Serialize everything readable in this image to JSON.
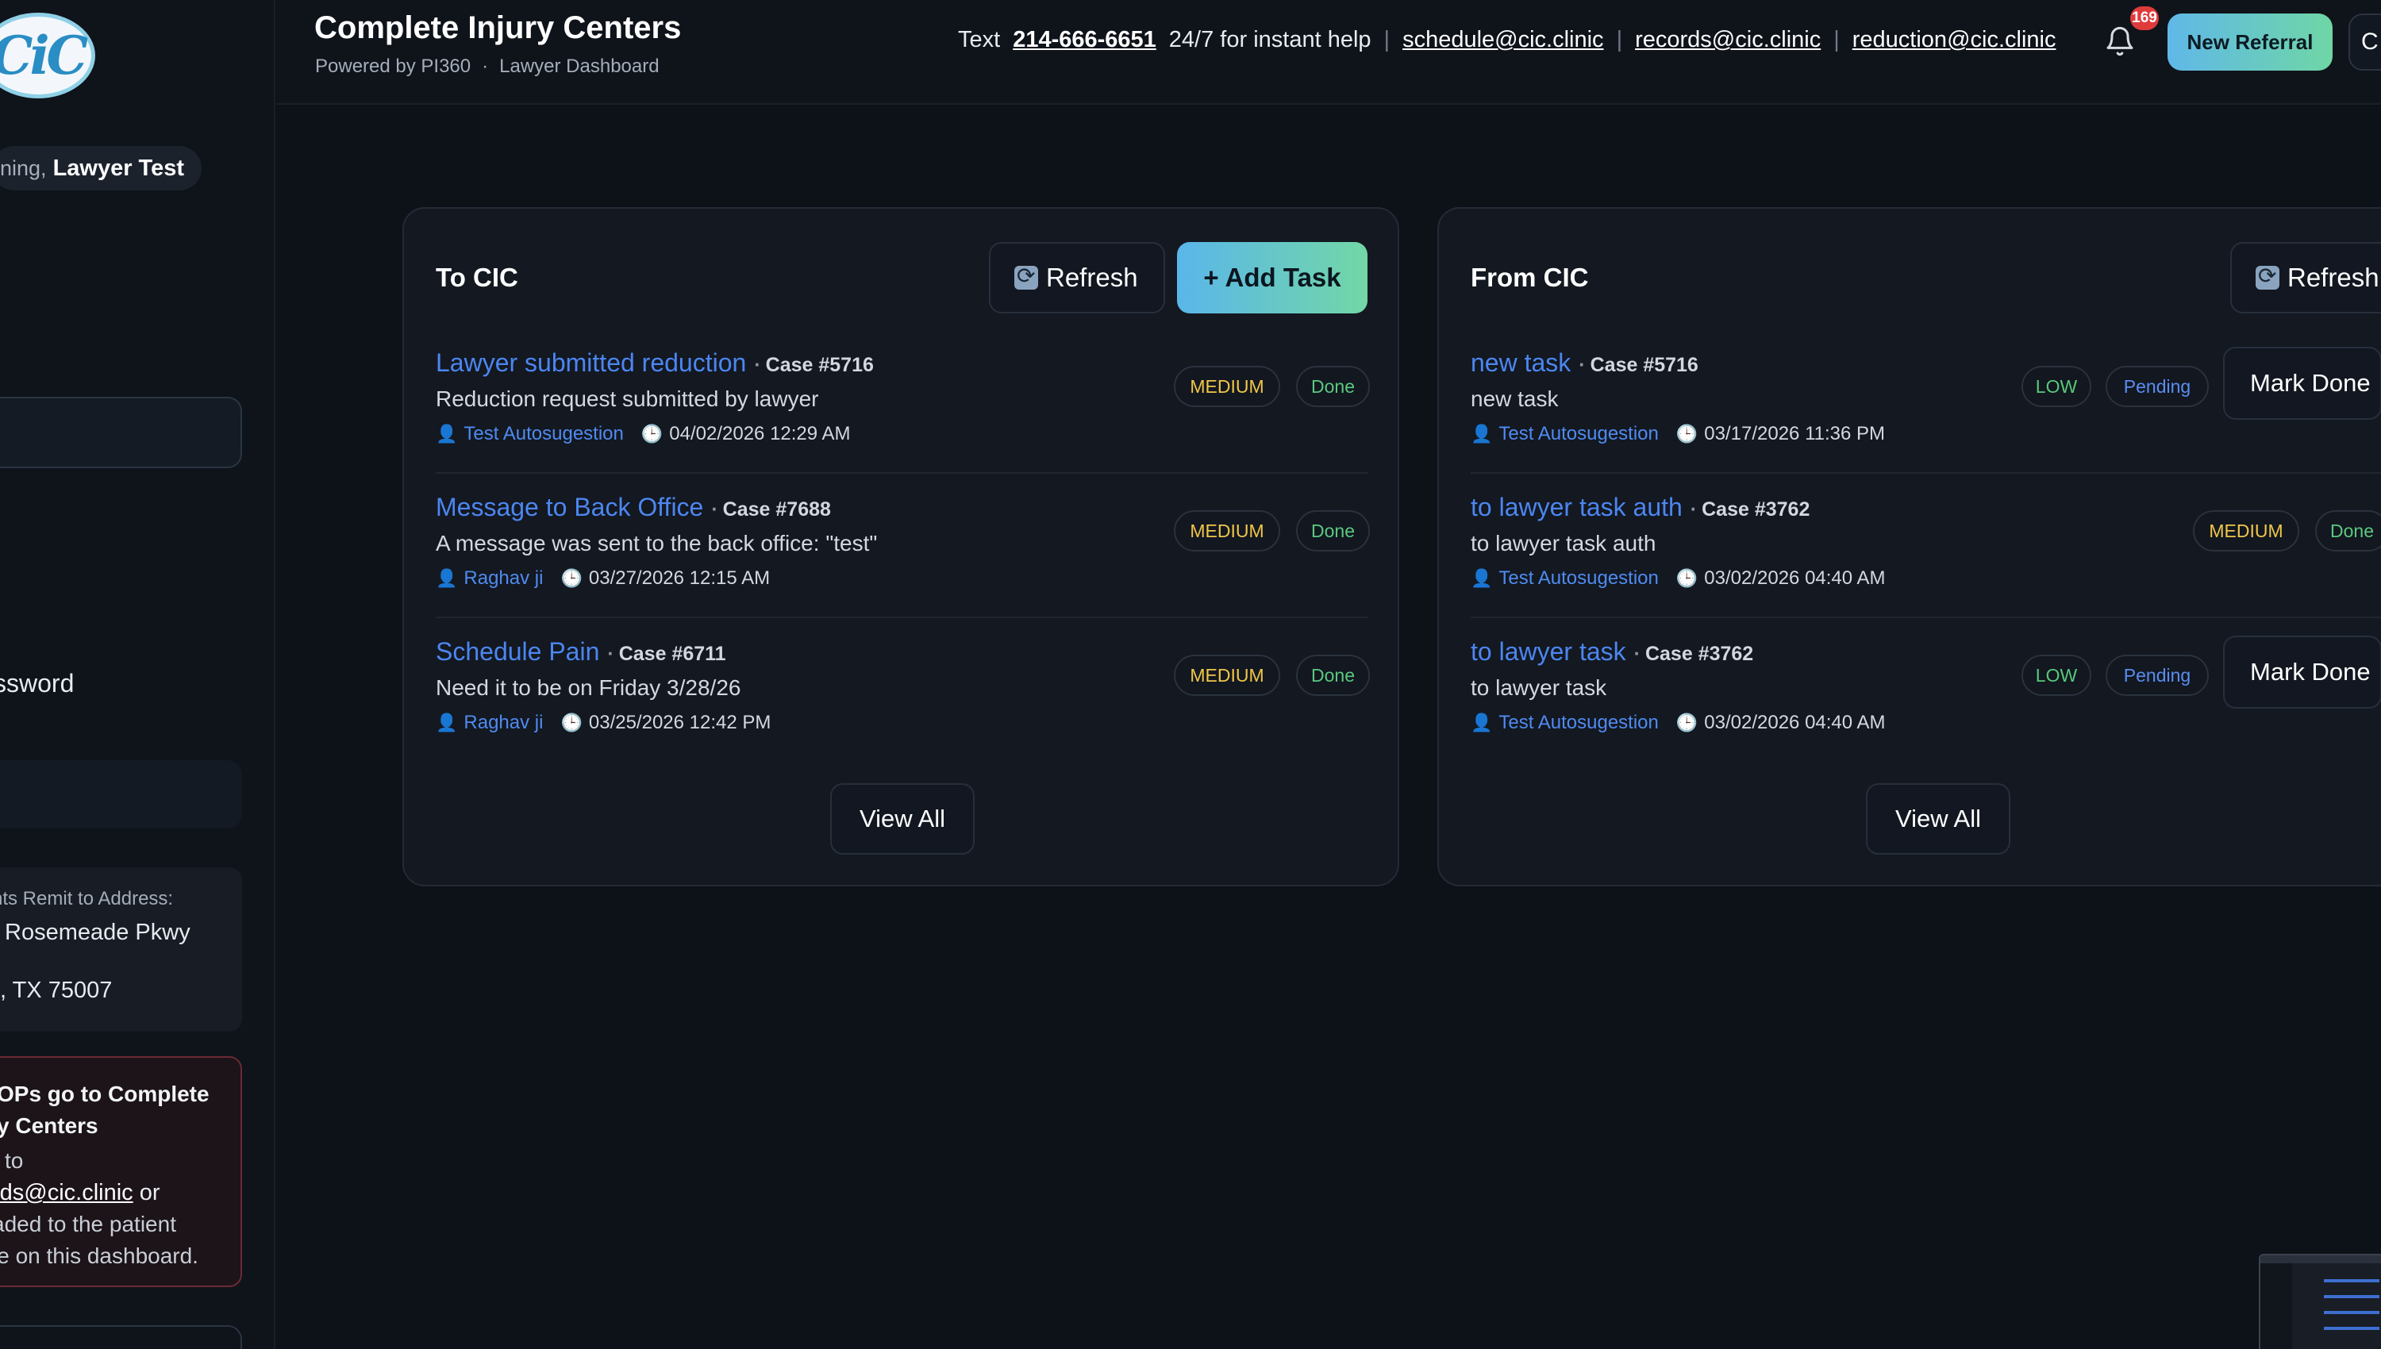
{
  "sidebar": {
    "logo_text": "CiC",
    "greeting_prefix": "ning,",
    "greeting_name": "Lawyer Test",
    "password_item": "ssword",
    "remit": {
      "title": "nts Remit to Address:",
      "line1": "Rosemeade Pkwy",
      "line2": ", TX 75007"
    },
    "alert": {
      "line1": "OPs go to Complete",
      "line2": "y Centers",
      "line3": "l to",
      "email": "rds@cic.clinic",
      "email_suffix": " or",
      "line5": "aded to the patient",
      "line6": "le on this dashboard."
    }
  },
  "header": {
    "title": "Complete Injury Centers",
    "powered_by": "Powered by PI360",
    "section": "Lawyer Dashboard",
    "contact_prefix": "Text",
    "phone": "214-666-6651",
    "contact_suffix": "24/7 for instant help",
    "emails": [
      "schedule@cic.clinic",
      "records@cic.clinic",
      "reduction@cic.clinic"
    ],
    "notification_count": "169",
    "new_referral_label": "New Referral",
    "second_button_label": "C"
  },
  "to_cic": {
    "title": "To CIC",
    "refresh_label": "Refresh",
    "add_task_label": "+ Add Task",
    "view_all_label": "View All",
    "tasks": [
      {
        "title": "Lawyer submitted reduction",
        "case": "Case #5716",
        "description": "Reduction request submitted by lawyer",
        "assignee": "Test Autosugestion",
        "date": "04/02/2026 12:29 AM",
        "priority": "MEDIUM",
        "status": "Done"
      },
      {
        "title": "Message to Back Office",
        "case": "Case #7688",
        "description": "A message was sent to the back office: \"test\"",
        "assignee": "Raghav ji",
        "date": "03/27/2026 12:15 AM",
        "priority": "MEDIUM",
        "status": "Done"
      },
      {
        "title": "Schedule Pain",
        "case": "Case #6711",
        "description": "Need it to be on Friday 3/28/26",
        "assignee": "Raghav ji",
        "date": "03/25/2026 12:42 PM",
        "priority": "MEDIUM",
        "status": "Done"
      }
    ]
  },
  "from_cic": {
    "title": "From CIC",
    "refresh_label": "Refresh",
    "view_all_label": "View All",
    "mark_done_label": "Mark Done",
    "tasks": [
      {
        "title": "new task",
        "case": "Case #5716",
        "description": "new task",
        "assignee": "Test Autosugestion",
        "date": "03/17/2026 11:36 PM",
        "priority": "LOW",
        "status": "Pending"
      },
      {
        "title": "to lawyer task auth",
        "case": "Case #3762",
        "description": "to lawyer task auth",
        "assignee": "Test Autosugestion",
        "date": "03/02/2026 04:40 AM",
        "priority": "MEDIUM",
        "status": "Done"
      },
      {
        "title": "to lawyer task",
        "case": "Case #3762",
        "description": "to lawyer task",
        "assignee": "Test Autosugestion",
        "date": "03/02/2026 04:40 AM",
        "priority": "LOW",
        "status": "Pending"
      }
    ]
  }
}
